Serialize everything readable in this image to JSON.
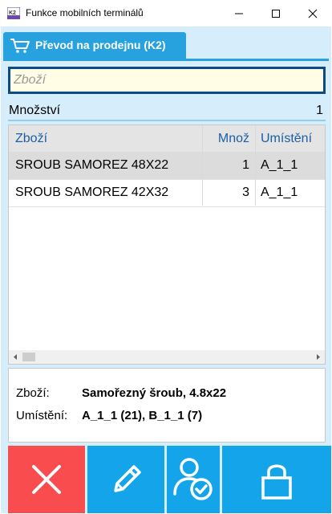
{
  "window": {
    "title": "Funkce mobilních terminálů",
    "icon_text": "K2"
  },
  "tab": {
    "label": "Převod na prodejnu (K2)",
    "icon": "cart-icon"
  },
  "search": {
    "placeholder": "Zboží",
    "value": ""
  },
  "quantity": {
    "label": "Množství",
    "value": "1"
  },
  "grid": {
    "columns": [
      "Zboží",
      "Množ",
      "Umístění"
    ],
    "rows": [
      {
        "item": "SROUB SAMOREZ 48X22",
        "qty": "1",
        "location": "A_1_1",
        "selected": true
      },
      {
        "item": "SROUB SAMOREZ 42X32",
        "qty": "3",
        "location": "A_1_1",
        "selected": false
      }
    ]
  },
  "detail": {
    "item_label": "Zboží:",
    "item_value": "Samořezný šroub, 4.8x22",
    "location_label": "Umístění:",
    "location_value": "A_1_1 (21), B_1_1 (7)"
  },
  "buttons": {
    "cancel_icon": "close-icon",
    "edit_icon": "pencil-icon",
    "user_icon": "user-check-icon",
    "lock_icon": "lock-icon"
  },
  "colors": {
    "accent": "#27a2de",
    "panel_bg": "#d6eefb",
    "cancel": "#f94c4e",
    "action": "#13a4ea",
    "search_border": "#0c4b86",
    "header_text": "#1b5ea6"
  }
}
